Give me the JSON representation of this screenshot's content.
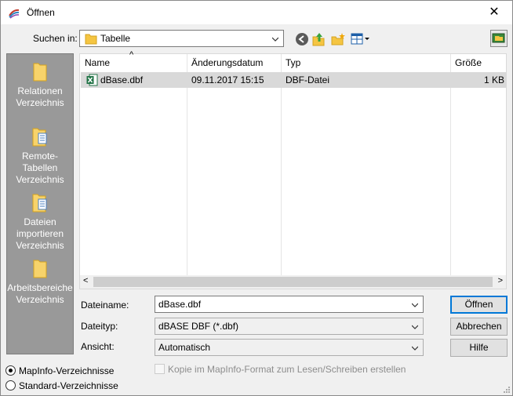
{
  "window": {
    "title": "Öffnen",
    "close_glyph": "✕"
  },
  "lookin": {
    "label": "Suchen in:",
    "value": "Tabelle"
  },
  "toolbar": {
    "icons": [
      "back-icon",
      "up-folder-icon",
      "new-folder-icon",
      "view-menu-icon",
      "desktop-icon"
    ]
  },
  "places": [
    {
      "label": "Relationen Verzeichnis",
      "icon": "folder-icon"
    },
    {
      "label": "Remote-Tabellen Verzeichnis",
      "icon": "folder-document-icon"
    },
    {
      "label": "Dateien importieren Verzeichnis",
      "icon": "folder-document-icon"
    },
    {
      "label": "Arbeitsbereiche Verzeichnis",
      "icon": "folder-icon"
    }
  ],
  "filelist": {
    "columns": [
      "Name",
      "Änderungsdatum",
      "Typ",
      "Größe"
    ],
    "sort_indicator": "^",
    "rows": [
      {
        "name": "dBase.dbf",
        "date": "09.11.2017 15:15",
        "type": "DBF-Datei",
        "size": "1 KB"
      }
    ],
    "scroll_left": "<",
    "scroll_right": ">"
  },
  "form": {
    "filename_label": "Dateiname:",
    "filename_value": "dBase.dbf",
    "filetype_label": "Dateityp:",
    "filetype_value": "dBASE DBF (*.dbf)",
    "view_label": "Ansicht:",
    "view_value": "Automatisch"
  },
  "buttons": {
    "open": "Öffnen",
    "cancel": "Abbrechen",
    "help": "Hilfe"
  },
  "checkbox": {
    "label": "Kopie im MapInfo-Format zum Lesen/Schreiben erstellen",
    "checked": false,
    "enabled": false
  },
  "radios": [
    {
      "label": "MapInfo-Verzeichnisse",
      "selected": true
    },
    {
      "label": "Standard-Verzeichnisse",
      "selected": false
    }
  ]
}
